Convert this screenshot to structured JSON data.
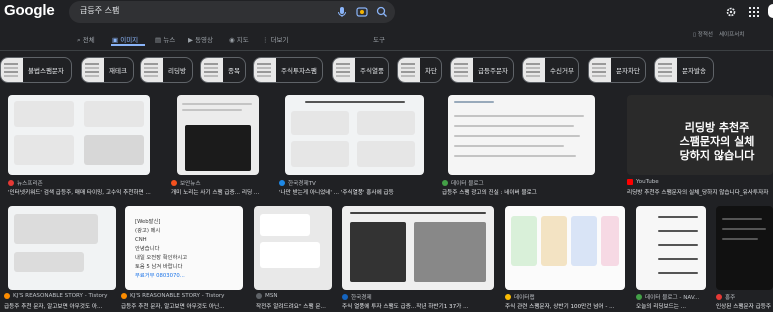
{
  "header": {
    "logo": "Google",
    "query": "급등주 스팸",
    "right_links": [
      "정적선",
      "세이프서치"
    ]
  },
  "tabs": [
    {
      "label": "전체",
      "active": false
    },
    {
      "label": "이미지",
      "active": true
    },
    {
      "label": "뉴스",
      "active": false
    },
    {
      "label": "동영상",
      "active": false
    },
    {
      "label": "지도",
      "active": false
    },
    {
      "label": "더보기",
      "active": false
    }
  ],
  "tools_label": "도구",
  "chips": [
    "불법스팸문자",
    "재테크",
    "리딩방",
    "종목",
    "주식투자스팸",
    "주식열풍",
    "차단",
    "급등주문자",
    "수신거부",
    "문자차단",
    "문자발송"
  ],
  "row1": [
    {
      "source": "뉴스프리존",
      "title": "'인터넷키워",
      "fav": "#e53935"
    },
    {
      "source": "보안뉴스",
      "title": "개미 노리는 사기 스팸 급증... 리딩 ...",
      "fav": "#f4511e"
    },
    {
      "source": "한국경제TV",
      "title": "'나만 받는게 아니었네' ... '주식열풍' 홍사에 급등",
      "fav": "#1e88e5"
    },
    {
      "source": "데이터 블로그",
      "title": "급등주 스팸 광고의 진실 : 네이버 블로그",
      "fav": "#43a047"
    },
    {
      "source": "YouTube",
      "title": "리딩방 추천주 스팸문자의 실체_당하지 않습니다_유사투자자",
      "fav": "#ff0000"
    }
  ],
  "row2": [
    {
      "source": "KJ'S REASONABLE STORY - Tistory",
      "title": "급등주 추천 문자, 알고보면 아무것도 아...",
      "fav": "#fb8c00"
    },
    {
      "source": "KJ'S REASONABLE STORY - Tistory",
      "title": "급등주 추천 문자, 알고보면 아무것도 아닌...",
      "fav": "#fb8c00"
    },
    {
      "source": "MSN",
      "title": "작전주 알려드려요\" 스팸 문...",
      "fav": "#5f6368"
    },
    {
      "source": "한국경제",
      "title": "주식 열풍에 투자 스팸도 급증...작년 하반기1 37가 ...",
      "fav": "#1565c0"
    },
    {
      "source": "데이터랩",
      "title": "주식 관련 스팸문자, 상반기 100만건 넘어 - ...",
      "fav": "#fbbc04"
    },
    {
      "source": "데이터 블로그 - NAV...",
      "title": "오늘의 리딩보드는 ...",
      "fav": "#43a047"
    },
    {
      "source": "홍주",
      "title": "인상된 스팸문자 급등주",
      "fav": "#e53935"
    }
  ],
  "thumb_texts": {
    "youtube": [
      "리딩방 추천주",
      "스팸문자의 실체",
      "당하지 않습니다"
    ],
    "phone_note": [
      "[Web발신]",
      "(광고) 메시",
      "CNH",
      "안녕습니다",
      "내일 오전장 확인하시고",
      "토음 5 남겨 바랍니다",
      "무료거부 0803070..."
    ]
  }
}
